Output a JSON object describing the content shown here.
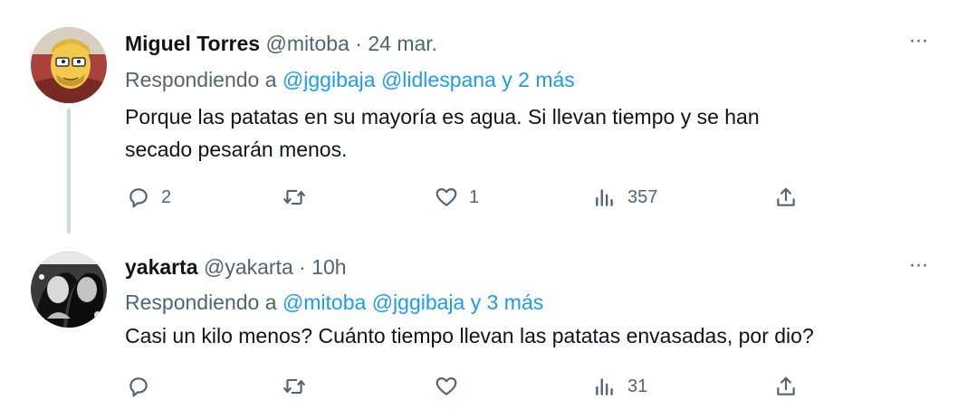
{
  "tweets": [
    {
      "display_name": "Miguel Torres",
      "handle": "@mitoba",
      "separator": "·",
      "time": "24 mar.",
      "more_label": "···",
      "reply_prefix": "Respondiendo a",
      "reply_targets": "@jggibaja @lidlespana y 2 más",
      "text_lines": [
        "Porque las patatas en su mayoría es agua. Si llevan tiempo y se han",
        "secado pesarán menos."
      ],
      "actions": {
        "replies": "2",
        "retweets": "",
        "likes": "1",
        "views": "357"
      }
    },
    {
      "display_name": "yakarta",
      "handle": "@yakarta",
      "separator": "·",
      "time": "10h",
      "more_label": "···",
      "reply_prefix": "Respondiendo a",
      "reply_targets": "@mitoba @jggibaja y 3 más",
      "text_lines": [
        "Casi un kilo menos? Cuánto tiempo llevan las patatas envasadas, por dio?"
      ],
      "actions": {
        "replies": "",
        "retweets": "",
        "likes": "",
        "views": "31"
      }
    }
  ],
  "colors": {
    "text_primary": "#0f1419",
    "text_secondary": "#536471",
    "link": "#1d9bf0",
    "thread_line": "#cfd9de"
  },
  "icons": [
    "reply-icon",
    "retweet-icon",
    "like-icon",
    "views-icon",
    "share-icon",
    "more-icon"
  ]
}
